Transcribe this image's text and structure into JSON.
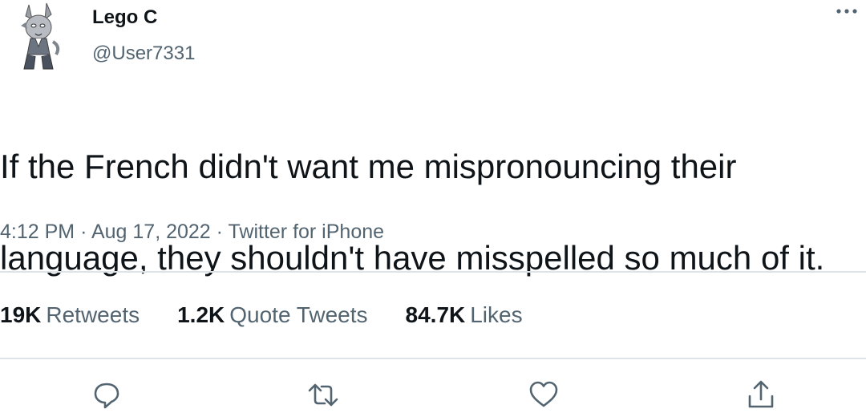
{
  "user": {
    "display_name": "Lego C",
    "handle": "@User7331",
    "avatar_icon": "wolf-character-avatar"
  },
  "tweet": {
    "text_line1": "If the French didn't want me mispronouncing their",
    "text_line2": "language, they shouldn't have misspelled so much of it."
  },
  "meta": {
    "time": "4:12 PM",
    "date": "Aug 17, 2022",
    "source": "Twitter for iPhone",
    "separator": "·"
  },
  "stats": [
    {
      "num": "19K",
      "label": "Retweets"
    },
    {
      "num": "1.2K",
      "label": "Quote Tweets"
    },
    {
      "num": "84.7K",
      "label": "Likes"
    }
  ],
  "actions": [
    "reply-icon",
    "retweet-icon",
    "like-icon",
    "share-icon"
  ],
  "colors": {
    "text": "#0f1419",
    "secondary": "#536471",
    "divider": "#dde3e7"
  }
}
